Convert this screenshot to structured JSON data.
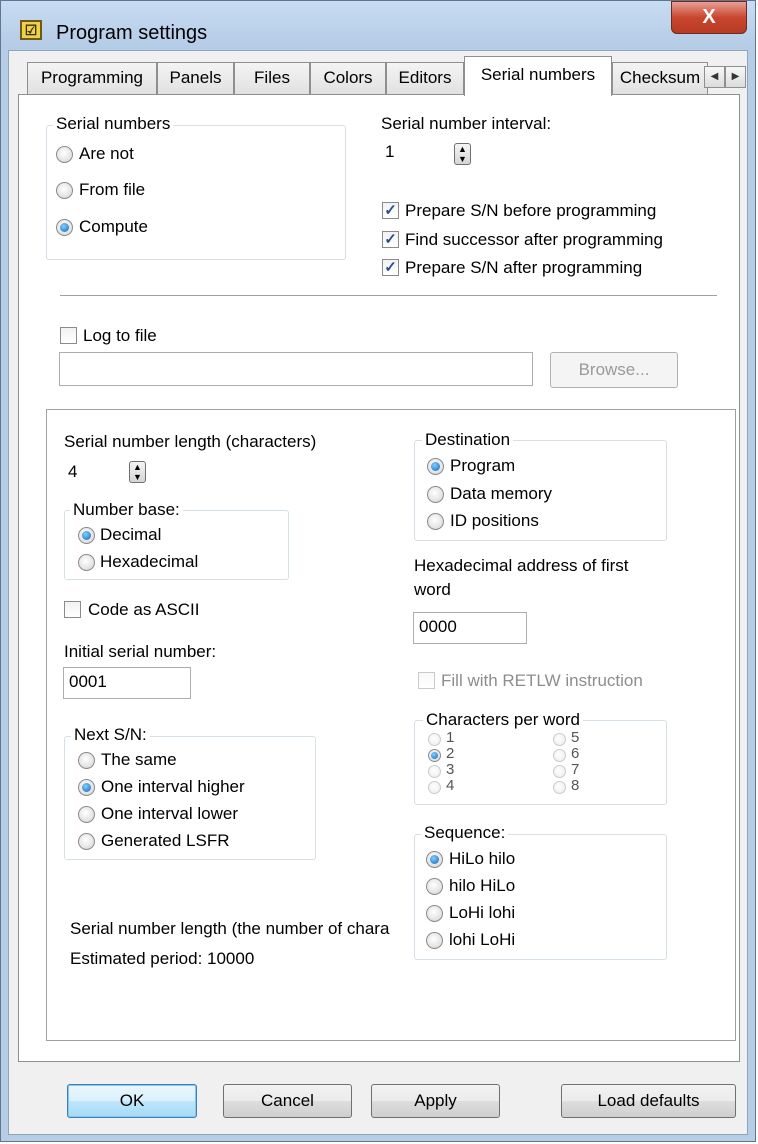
{
  "window": {
    "title": "Program settings",
    "close_glyph": "X",
    "app_icon_glyph": "☑"
  },
  "tabs": [
    "Programming",
    "Panels",
    "Files",
    "Colors",
    "Editors",
    "Serial numbers",
    "Checksum"
  ],
  "active_tab": "Serial numbers",
  "tab_scroll": {
    "left": "◀",
    "right": "▶"
  },
  "serial_numbers_group": {
    "legend": "Serial numbers",
    "options": [
      "Are not",
      "From file",
      "Compute"
    ],
    "selected": "Compute"
  },
  "interval": {
    "label": "Serial number interval:",
    "value": "1"
  },
  "checkboxes": [
    {
      "label": "Prepare S/N before programming",
      "checked": true
    },
    {
      "label": "Find successor after programming",
      "checked": true
    },
    {
      "label": "Prepare S/N after programming",
      "checked": true
    }
  ],
  "log": {
    "label": "Log to file",
    "checked": false,
    "path": "",
    "browse_label": "Browse..."
  },
  "length": {
    "label": "Serial number length (characters)",
    "value": "4"
  },
  "number_base": {
    "legend": "Number base:",
    "options": [
      "Decimal",
      "Hexadecimal"
    ],
    "selected": "Decimal"
  },
  "code_ascii": {
    "label": "Code as ASCII",
    "checked": false
  },
  "initial": {
    "label": "Initial serial number:",
    "value": "0001"
  },
  "next_sn": {
    "legend": "Next S/N:",
    "options": [
      "The same",
      "One interval higher",
      "One interval lower",
      "Generated LSFR"
    ],
    "selected": "One interval higher"
  },
  "destination": {
    "legend": "Destination",
    "options": [
      "Program",
      "Data memory",
      "ID positions"
    ],
    "selected": "Program"
  },
  "hex_address": {
    "label_line1": "Hexadecimal address of first",
    "label_line2": "word",
    "value": "0000"
  },
  "fill_retlw": {
    "label": "Fill with RETLW instruction",
    "checked": false,
    "disabled": true
  },
  "chars_per_word": {
    "legend": "Characters per word",
    "options": [
      "1",
      "2",
      "3",
      "4",
      "5",
      "6",
      "7",
      "8"
    ],
    "selected": "2"
  },
  "sequence": {
    "legend": "Sequence:",
    "options": [
      "HiLo hilo",
      "hilo HiLo",
      "LoHi lohi",
      "lohi LoHi"
    ],
    "selected": "HiLo hilo"
  },
  "info": {
    "line1": "Serial number length (the number of chara",
    "line2": "Estimated period: 10000"
  },
  "buttons": {
    "ok": "OK",
    "cancel": "Cancel",
    "apply": "Apply",
    "load_defaults": "Load defaults"
  }
}
